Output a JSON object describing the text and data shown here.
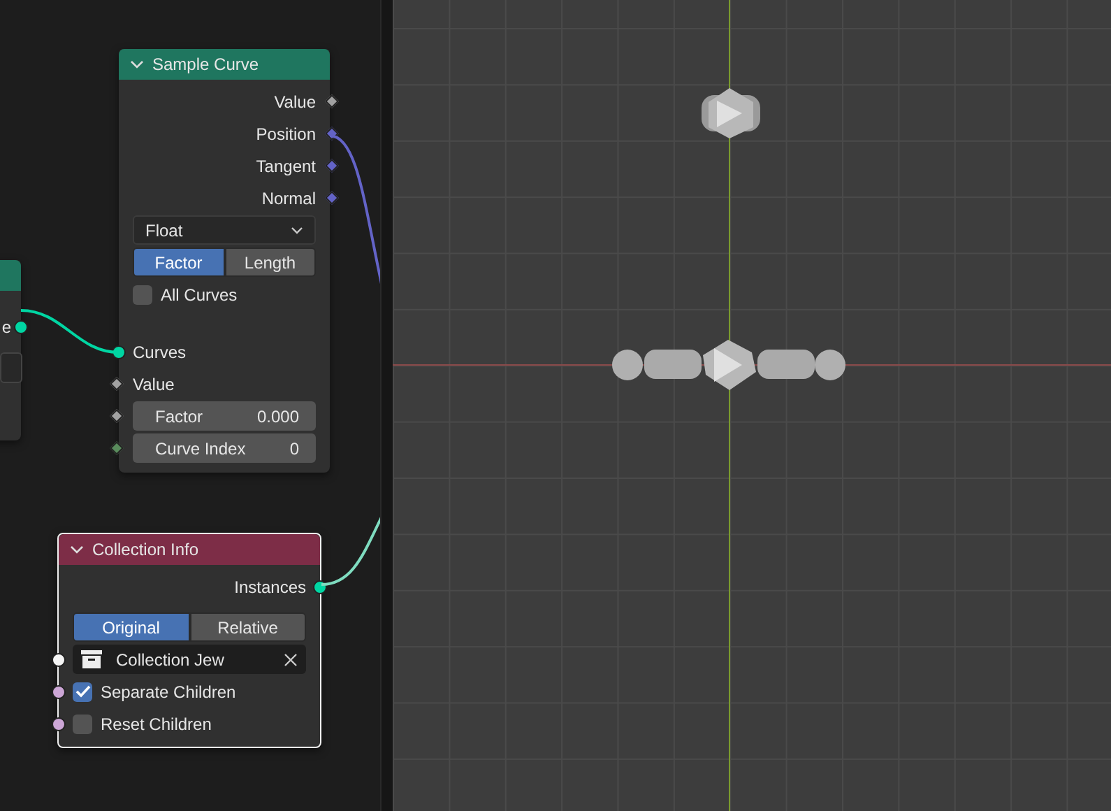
{
  "partial_node": {
    "outputs": [
      {
        "label": "e",
        "kind": "geometry"
      }
    ]
  },
  "sample_curve": {
    "title": "Sample Curve",
    "outputs": [
      {
        "label": "Value",
        "kind": "float"
      },
      {
        "label": "Position",
        "kind": "vector"
      },
      {
        "label": "Tangent",
        "kind": "vector"
      },
      {
        "label": "Normal",
        "kind": "vector"
      }
    ],
    "data_type": "Float",
    "modes": [
      {
        "label": "Factor",
        "selected": true
      },
      {
        "label": "Length",
        "selected": false
      }
    ],
    "all_curves": {
      "label": "All Curves",
      "checked": false
    },
    "inputs": [
      {
        "label": "Curves",
        "kind": "geometry"
      },
      {
        "label": "Value",
        "kind": "float"
      },
      {
        "label": "Factor",
        "value": "0.000",
        "kind": "float"
      },
      {
        "label": "Curve Index",
        "value": "0",
        "kind": "int"
      }
    ]
  },
  "collection_info": {
    "title": "Collection Info",
    "outputs": [
      {
        "label": "Instances",
        "kind": "geometry"
      }
    ],
    "modes": [
      {
        "label": "Original",
        "selected": true
      },
      {
        "label": "Relative",
        "selected": false
      }
    ],
    "collection": {
      "value": "Collection Jew",
      "kind": "collection"
    },
    "options": [
      {
        "label": "Separate Children",
        "checked": true,
        "kind": "boolean"
      },
      {
        "label": "Reset Children",
        "checked": false,
        "kind": "boolean"
      }
    ]
  }
}
